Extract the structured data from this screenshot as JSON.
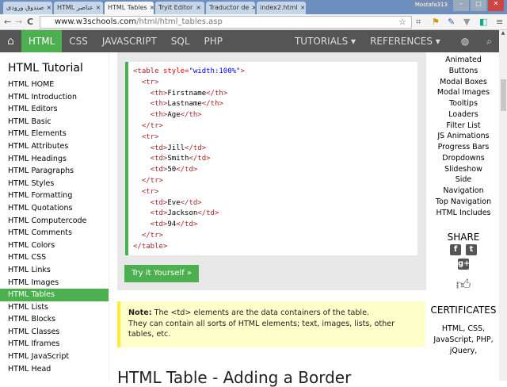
{
  "browser": {
    "tabs": [
      {
        "label": "صندوق ورودی",
        "active": false
      },
      {
        "label": "HTML عناصر",
        "active": false
      },
      {
        "label": "HTML Tables",
        "active": true
      },
      {
        "label": "Tryit Editor",
        "active": false
      },
      {
        "label": "Traductor de",
        "active": false
      },
      {
        "label": "index2.html",
        "active": false
      }
    ],
    "user": "Mostafa313",
    "url_host": "www.w3schools.com",
    "url_path": "/html/html_tables.asp"
  },
  "nav": {
    "items": [
      "HTML",
      "CSS",
      "JAVASCRIPT",
      "SQL",
      "PHP"
    ],
    "tutorials": "TUTORIALS ▾",
    "references": "REFERENCES ▾"
  },
  "sidebar": {
    "title": "HTML Tutorial",
    "items": [
      "HTML HOME",
      "HTML Introduction",
      "HTML Editors",
      "HTML Basic",
      "HTML Elements",
      "HTML Attributes",
      "HTML Headings",
      "HTML Paragraphs",
      "HTML Styles",
      "HTML Formatting",
      "HTML Quotations",
      "HTML Computercode",
      "HTML Comments",
      "HTML Colors",
      "HTML CSS",
      "HTML Links",
      "HTML Images",
      "HTML Tables",
      "HTML Lists",
      "HTML Blocks",
      "HTML Classes",
      "HTML Iframes",
      "HTML JavaScript",
      "HTML Head"
    ],
    "active": "HTML Tables"
  },
  "code": {
    "first_tag": "<table ",
    "attr": "style=",
    "val": "\"width:100%\"",
    "first_close": ">",
    "lines": [
      [
        "  <tr>",
        "",
        ""
      ],
      [
        "    <th>",
        "Firstname",
        "</th>"
      ],
      [
        "    <th>",
        "Lastname",
        "</th>"
      ],
      [
        "    <th>",
        "Age",
        "</th>"
      ],
      [
        "  </tr>",
        "",
        ""
      ],
      [
        "  <tr>",
        "",
        ""
      ],
      [
        "    <td>",
        "Jill",
        "</td>"
      ],
      [
        "    <td>",
        "Smith",
        "</td>"
      ],
      [
        "    <td>",
        "50",
        "</td>"
      ],
      [
        "  </tr>",
        "",
        ""
      ],
      [
        "  <tr>",
        "",
        ""
      ],
      [
        "    <td>",
        "Eve",
        "</td>"
      ],
      [
        "    <td>",
        "Jackson",
        "</td>"
      ],
      [
        "    <td>",
        "94",
        "</td>"
      ],
      [
        "  </tr>",
        "",
        ""
      ],
      [
        "</table>",
        "",
        ""
      ]
    ]
  },
  "try_button": "Try it Yourself »",
  "note": {
    "label": "Note:",
    "line1": " The <td> elements are the data containers of the table.",
    "line2": "They can contain all sorts of HTML elements; text, images, lists, other tables, etc."
  },
  "heading": "HTML Table - Adding a Border",
  "right": {
    "items": [
      "Animated",
      "Buttons",
      "Modal Boxes",
      "Modal Images",
      "Tooltips",
      "Loaders",
      "Filter List",
      "JS Animations",
      "Progress Bars",
      "Dropdowns",
      "Slideshow",
      "Side",
      "Navigation",
      "Top Navigation",
      "HTML Includes"
    ],
    "share": "SHARE",
    "certificates": "CERTIFICATES",
    "cert_text": "HTML, CSS, JavaScript, PHP, jQuery,"
  },
  "colors": {
    "accent": "#4caf50",
    "nav": "#555555",
    "note_bg": "#ffffcc",
    "note_border": "#ffeb3b"
  }
}
